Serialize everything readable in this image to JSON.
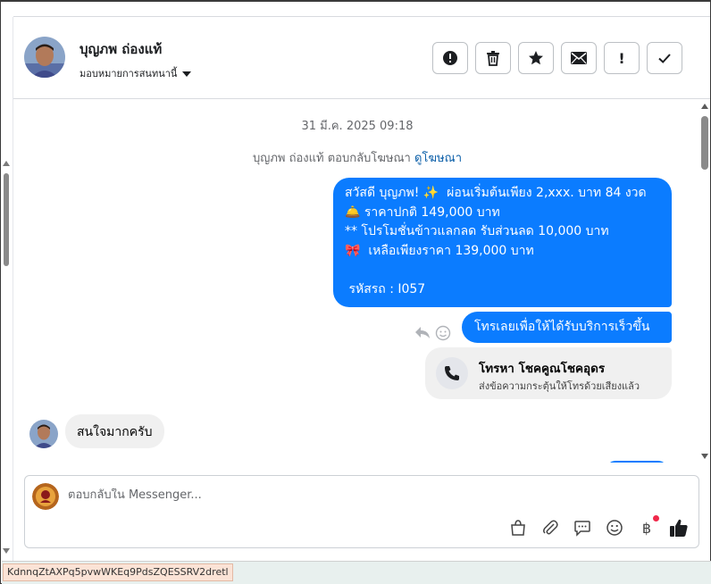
{
  "header": {
    "contact_name": "บุญภพ ถ่องแท้",
    "assign_label": "มอบหมายการสนทนานี้",
    "actions": [
      {
        "name": "spam-button",
        "icon": "alert-circle-icon"
      },
      {
        "name": "delete-button",
        "icon": "trash-icon"
      },
      {
        "name": "star-button",
        "icon": "star-icon"
      },
      {
        "name": "mark-unread-button",
        "icon": "envelope-icon"
      },
      {
        "name": "follow-up-button",
        "icon": "exclamation-icon",
        "glyph": "!"
      },
      {
        "name": "done-button",
        "icon": "checkmark-icon"
      }
    ]
  },
  "thread": {
    "timestamp": "31 มี.ค. 2025 09:18",
    "ad_reply_prefix": "บุญภพ ถ่องแท้ ตอบกลับโฆษณา",
    "ad_reply_link": "ดูโฆษณา",
    "outgoing_message": "สวัสดี บุญภพ! ✨  ผ่อนเริ่มต้นเพียง 2,xxx. บาท 84 งวด\n🛎️ ราคาปกติ 149,000 บาท\n** โปรโมชั่นข้าวแลกลด รับส่วนลด 10,000 บาท\n🎀  เหลือเพียงราคา 139,000 บาท\n\n รหัสรถ : I057",
    "quick_reply": "โทรเลยเพื่อให้ได้รับบริการเร็วขึ้น",
    "call_card": {
      "title": "โทรหา โชคคูณโชคอุดร",
      "subtitle": "ส่งข้อความกระตุ้นให้โทรด้วยเสียงแล้ว"
    },
    "incoming_message": "สนใจมากครับ"
  },
  "composer": {
    "placeholder": "ตอบกลับใน Messenger...",
    "tools": [
      "shopping-bag-icon",
      "paperclip-icon",
      "saved-reply-icon",
      "emoji-icon",
      "baht-icon",
      "thumbs-up-icon"
    ],
    "baht_glyph": "฿"
  },
  "status": {
    "url_fragment": "KdnnqZtAXPq5pvwWKEq9PdsZQESSRV2dretl"
  },
  "colors": {
    "outgoing_bubble": "#0b7cff",
    "incoming_bubble": "#f0f0f0",
    "link": "#0a5ea8",
    "notification_dot": "#f0284a"
  }
}
